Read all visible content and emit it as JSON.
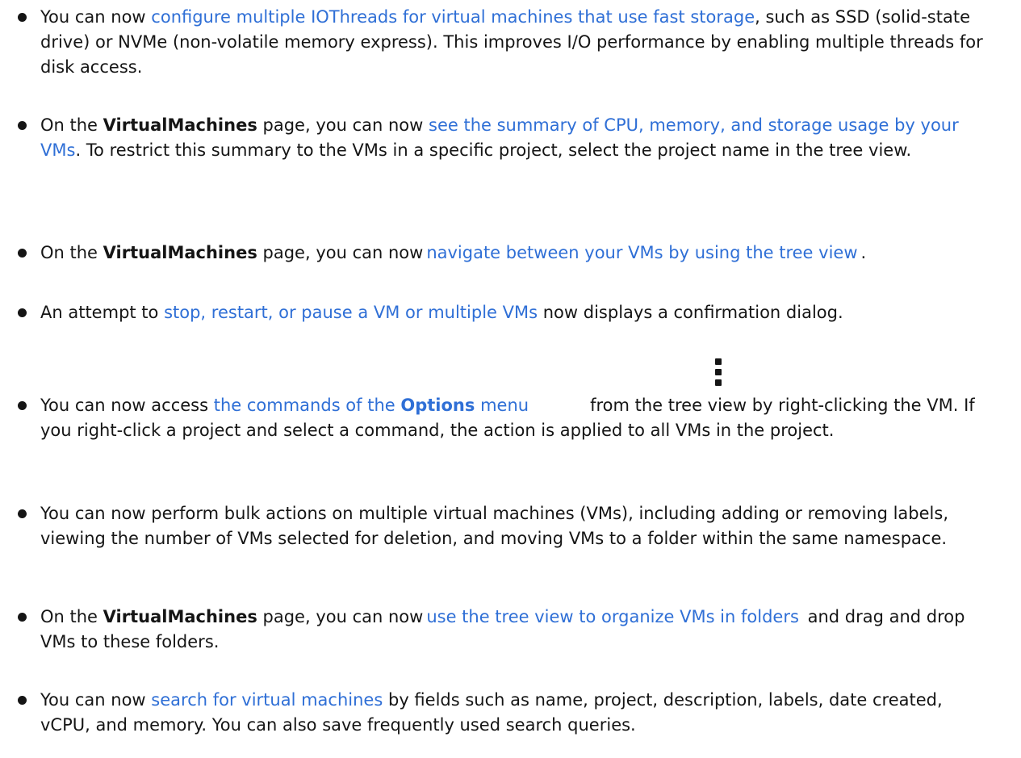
{
  "items": [
    {
      "a": "You can now",
      "link": "configure multiple IOThreads for virtual machines that use fast storage",
      "b": ", such as SSD (solid-state drive) or NVMe (non-volatile memory express). This improves I/O performance by enabling multiple threads for disk access."
    },
    {
      "a": "On the",
      "bold": "VirtualMachines",
      "b": "page, you can now",
      "link": "see the summary of CPU, memory, and storage usage by your VMs",
      "c": ". To restrict this summary to the VMs in a specific project, select the project name in the tree view."
    },
    {
      "a": "On the",
      "bold": "VirtualMachines",
      "b": "page, you can now",
      "link": "navigate between your VMs by using the tree view",
      "c": "."
    },
    {
      "a": "An attempt to",
      "link": "stop, restart, or pause a VM or multiple VMs",
      "b": "now displays a confirmation dialog."
    },
    {
      "a": "You can now access",
      "link_a": "the commands of the",
      "link_bold": "Options",
      "link_b": "menu",
      "icon": "kebab-menu-icon",
      "b": "from the tree view by right-clicking the VM. If you right-click a project and select a command, the action is applied to all VMs in the project."
    },
    {
      "a": "You can now perform bulk actions on multiple virtual machines (VMs), including adding or removing labels, viewing the number of VMs selected for deletion, and moving VMs to a folder within the same namespace."
    },
    {
      "a": "On the",
      "bold": "VirtualMachines",
      "b": "page, you can now",
      "link": "use the tree view to organize VMs in folders",
      "c": "and drag and drop VMs to these folders."
    },
    {
      "a": "You can now",
      "link": "search for virtual machines",
      "b": "by fields such as name, project, description, labels, date created, vCPU, and memory. You can also save frequently used search queries."
    }
  ],
  "colors": {
    "text": "#151515",
    "link": "#2f6fd6"
  }
}
